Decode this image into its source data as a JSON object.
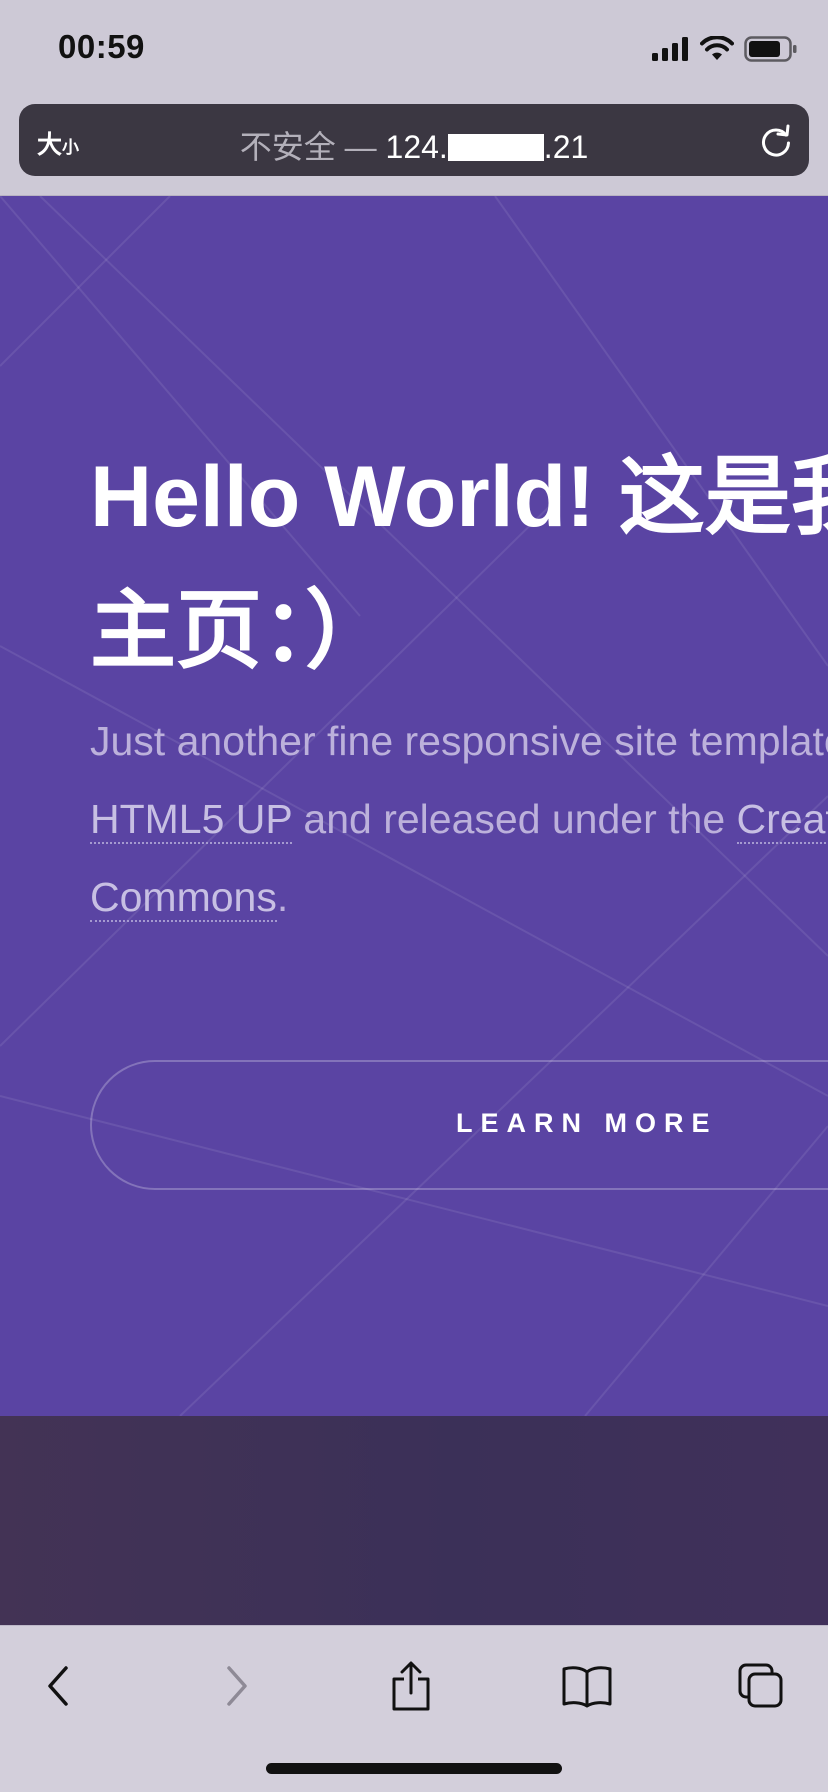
{
  "status_bar": {
    "time": "00:59"
  },
  "address_bar": {
    "text_size_big": "大",
    "text_size_small": "小",
    "insecure_label": "不安全 — ",
    "ip_prefix": "124.",
    "ip_suffix": ".21"
  },
  "hero": {
    "title": "Hello World! 这是我的个人主页：）",
    "desc_part1": "Just another fine responsive site template designed by ",
    "link1": "HTML5 UP",
    "desc_part2": " and released under the ",
    "link2": "Creative Commons",
    "desc_part3": ".",
    "button_label": "LEARN MORE"
  },
  "toolbar": {
    "back": "back-icon",
    "forward": "forward-icon",
    "share": "share-icon",
    "bookmarks": "bookmarks-icon",
    "tabs": "tabs-icon"
  },
  "colors": {
    "hero_bg": "#5a44a3",
    "band_bg": "#3d3058",
    "address_bg": "#3b3742"
  }
}
